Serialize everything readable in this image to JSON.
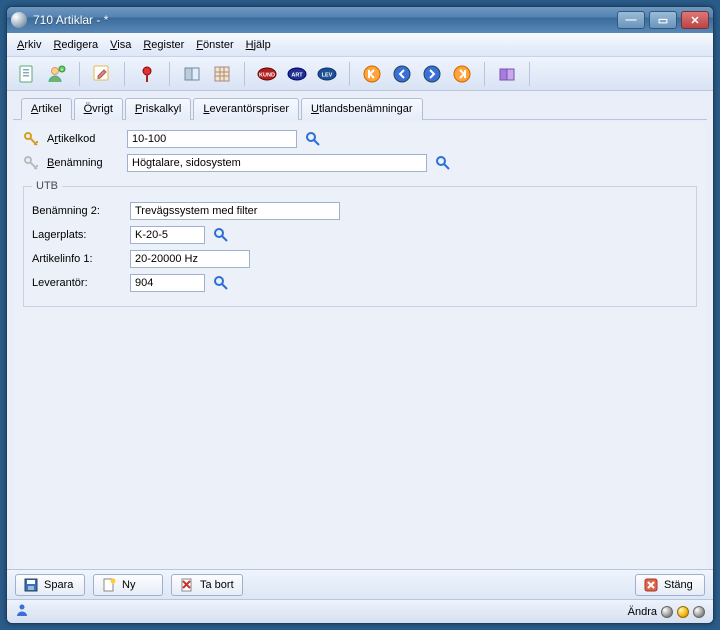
{
  "window": {
    "title": "710 Artiklar - *"
  },
  "menu": {
    "arkiv": "Arkiv",
    "redigera": "Redigera",
    "visa": "Visa",
    "register": "Register",
    "fonster": "Fönster",
    "hjalp": "Hjälp"
  },
  "tabs": {
    "artikel": "Artikel",
    "ovrigt": "Övrigt",
    "priskalkyl": "Priskalkyl",
    "leverantorspriser": "Leverantörspriser",
    "utlandsbenamningar": "Utlandsbenämningar"
  },
  "form": {
    "artikelkod_label": "Artikelkod",
    "artikelkod": "10-100",
    "benamning_label": "Benämning",
    "benamning": "Högtalare, sidosystem"
  },
  "group": {
    "title": "UTB",
    "benamning2_label": "Benämning 2:",
    "benamning2": "Trevägssystem med filter",
    "lagerplats_label": "Lagerplats:",
    "lagerplats": "K-20-5",
    "artikelinfo1_label": "Artikelinfo 1:",
    "artikelinfo1": "20-20000 Hz",
    "leverantor_label": "Leverantör:",
    "leverantor": "904"
  },
  "buttons": {
    "spara": "Spara",
    "ny": "Ny",
    "tabort": "Ta bort",
    "stang": "Stäng"
  },
  "status": {
    "mode": "Ändra"
  }
}
